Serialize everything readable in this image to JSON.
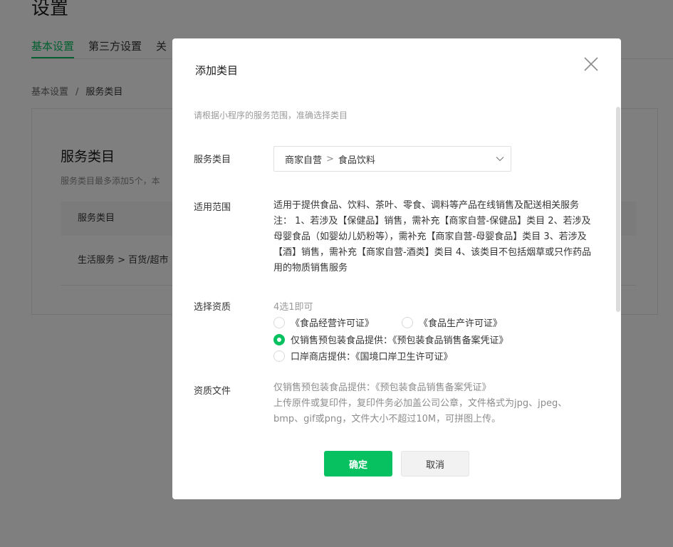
{
  "page": {
    "title": "设置",
    "tabs": [
      "基本设置",
      "第三方设置",
      "关"
    ],
    "breadcrumb": {
      "parent": "基本设置",
      "separator": "/",
      "current": "服务类目"
    },
    "card": {
      "title": "服务类目",
      "desc": "服务类目最多添加5个，本",
      "table_header": "服务类目",
      "row": "生活服务  >  百货/超市"
    }
  },
  "dialog": {
    "title": "添加类目",
    "hint": "请根据小程序的服务范围，准确选择类目",
    "category": {
      "label": "服务类目",
      "level1": "商家自营",
      "separator": ">",
      "level2": "食品饮料"
    },
    "scope": {
      "label": "适用范围",
      "text": "适用于提供食品、饮料、茶叶、零食、调料等产品在线销售及配送相关服务 注： 1、若涉及【保健品】销售，需补充【商家自营-保健品】类目 2、若涉及母婴食品（如婴幼儿奶粉等），需补充【商家自营-母婴食品】类目 3、若涉及【酒】销售，需补充【商家自营-酒类】类目 4、该类目不包括烟草或只作药品用的物质销售服务"
    },
    "qualification": {
      "label": "选择资质",
      "tip": "4选1即可",
      "options": [
        {
          "label": "《食品经营许可证》",
          "selected": false
        },
        {
          "label": "《食品生产许可证》",
          "selected": false
        },
        {
          "label": "仅销售预包装食品提供：《预包装食品销售备案凭证》",
          "selected": true
        },
        {
          "label": "口岸商店提供：《国境口岸卫生许可证》",
          "selected": false
        }
      ]
    },
    "file": {
      "label": "资质文件",
      "line1": "仅销售预包装食品提供：《预包装食品销售备案凭证》",
      "line2": "上传原件或复印件，复印件务必加盖公司公章，文件格式为jpg、jpeg、bmp、gif或png，文件大小不超过10M，可拼图上传。"
    },
    "buttons": {
      "ok": "确定",
      "cancel": "取消"
    }
  },
  "colors": {
    "accent": "#07c160",
    "overlay": "rgba(0,0,0,0.5)"
  },
  "icons": {
    "close": "close-icon",
    "dropdown": "chevron-down-icon"
  }
}
